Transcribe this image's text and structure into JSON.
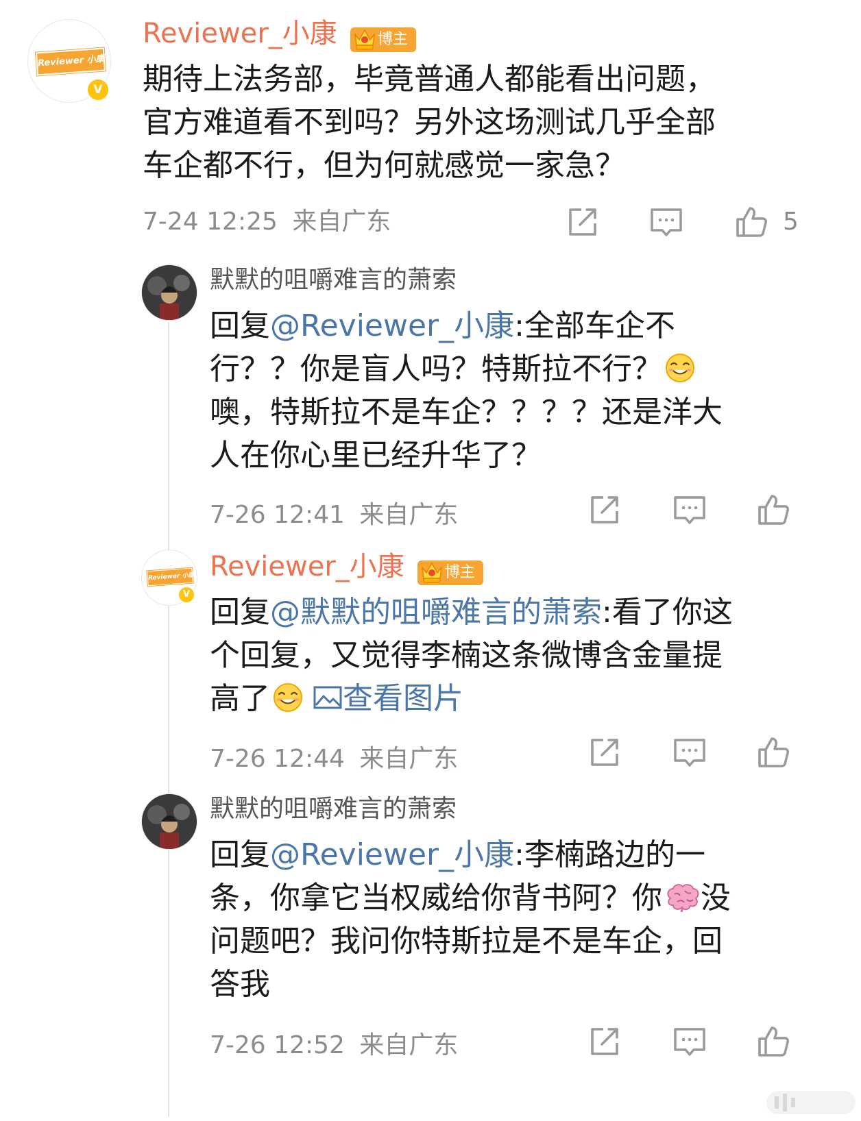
{
  "main_comment": {
    "author": "Reviewer_小康",
    "avatar_text": "Reviewer 小康",
    "badge": "博主",
    "lines": [
      "期待上法务部，毕竟普通人都能看出问题，",
      "官方难道看不到吗？另外这场测试几乎全部",
      "车企都不行，但为何就感觉一家急？"
    ],
    "time": "7-24 12:25",
    "location": "来自广东",
    "like_count": "5"
  },
  "replies": [
    {
      "author": "默默的咀嚼难言的萧索",
      "prefix": "回复",
      "mention": "@Reviewer_小康",
      "line1_rest": ":全部车企不",
      "lines": [
        "行？？你是盲人吗？特斯拉不行？",
        "噢，特斯拉不是车企？？？？还是洋大",
        "人在你心里已经升华了？"
      ],
      "time": "7-26 12:41",
      "location": "来自广东"
    },
    {
      "author": "Reviewer_小康",
      "badge": "博主",
      "prefix": "回复",
      "mention": "@默默的咀嚼难言的萧索",
      "line1_rest": ":看了你这",
      "lines": [
        "个回复，又觉得李楠这条微博含金量提",
        "高了"
      ],
      "view_image": "查看图片",
      "time": "7-26 12:44",
      "location": "来自广东"
    },
    {
      "author": "默默的咀嚼难言的萧索",
      "prefix": "回复",
      "mention": "@Reviewer_小康",
      "line1_rest": ":李楠路边的一",
      "line2_a": "条，你拿它当权威给你背书阿？你",
      "line2_b": "没",
      "lines": [
        "问题吧？我问你特斯拉是不是车企，回",
        "答我"
      ],
      "time": "7-26 12:52",
      "location": "来自广东"
    }
  ],
  "icons": {
    "share": "share-icon",
    "comment": "comment-icon",
    "like": "like-icon",
    "smile_emoji": "smile-emoji",
    "brain_emoji": "brain-emoji",
    "image": "image-icon"
  },
  "colors": {
    "name_orange": "#eb7350",
    "mention_blue": "#4a76a8",
    "meta_gray": "#8c8c8c",
    "badge_orange": "#f6a532",
    "verify_yellow": "#ffc20e"
  }
}
